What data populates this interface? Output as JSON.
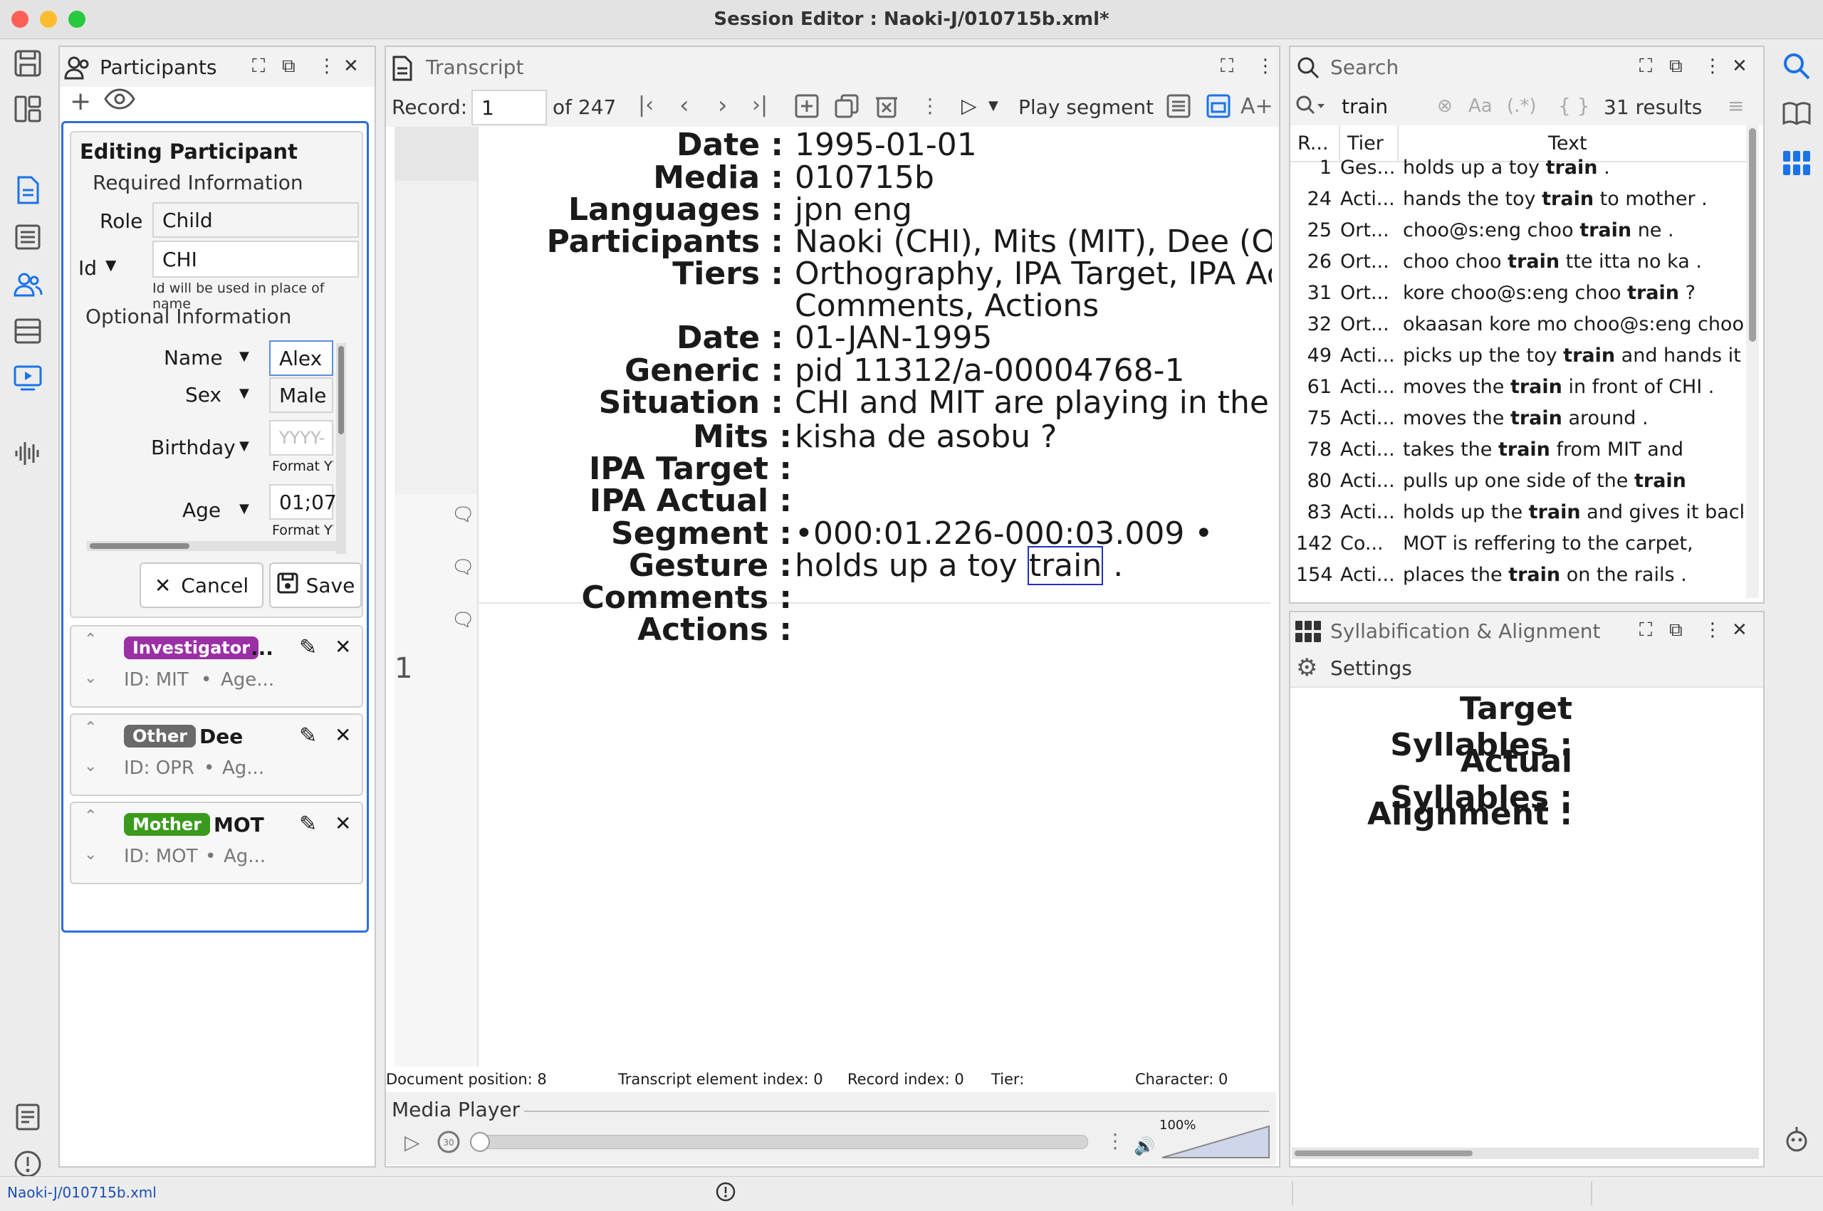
{
  "window": {
    "title": "Session Editor : Naoki-J/010715b.xml*"
  },
  "participants": {
    "title": "Participants",
    "editing_title": "Editing Participant",
    "required_label": "Required Information",
    "role_label": "Role",
    "role_value": "Child",
    "id_label": "Id",
    "id_value": "CHI",
    "id_hint": "Id will be used in place of name",
    "optional_label": "Optional Information",
    "name_label": "Name",
    "name_value": "Alex",
    "sex_label": "Sex",
    "sex_value": "Male",
    "birthday_label": "Birthday",
    "birthday_placeholder": "YYYY-",
    "format1": "Format YY",
    "age_label": "Age",
    "age_value": "01;07",
    "format2": "Format YY",
    "cancel_label": "Cancel",
    "save_label": "Save",
    "cards": [
      {
        "badge": "Investigator",
        "badge_color": "#9b2fa6",
        "name": "...",
        "id_text": "ID: MIT",
        "age_text": "Age..."
      },
      {
        "badge": "Other",
        "badge_color": "#6a6a6a",
        "name": "Dee",
        "id_text": "ID: OPR",
        "age_text": "Ag..."
      },
      {
        "badge": "Mother",
        "badge_color": "#3a9a1c",
        "name": "MOT",
        "id_text": "ID: MOT",
        "age_text": "Ag..."
      }
    ]
  },
  "transcript": {
    "title": "Transcript",
    "record_label": "Record:",
    "record_value": "1",
    "of_total": "of 247",
    "play_label": "Play segment",
    "header_rows": [
      {
        "label": "Date :",
        "value": "1995-01-01"
      },
      {
        "label": "Media :",
        "value": "010715b"
      },
      {
        "label": "Languages :",
        "value": "jpn eng"
      },
      {
        "label": "Participants :",
        "value": "Naoki (CHI), Mits (MIT), Dee (OPR), M"
      },
      {
        "label": "Tiers :",
        "value": "Orthography, IPA Target, IPA Actua"
      },
      {
        "label": "",
        "value": "Comments, Actions"
      },
      {
        "label": "Date :",
        "value": "01-JAN-1995"
      },
      {
        "label": "Generic :",
        "value": "pid 11312/a-00004768-1"
      },
      {
        "label": "Situation :",
        "value": "CHI and MIT are playing in the livin"
      }
    ],
    "record_number": "1",
    "record_rows": [
      {
        "label": "Mits :",
        "value": "kisha de asobu ?"
      },
      {
        "label": "IPA Target :",
        "value": ""
      },
      {
        "label": "IPA Actual :",
        "value": ""
      },
      {
        "label": "Segment :",
        "value": "•000:01.226-000:03.009 •"
      },
      {
        "label": "Gesture :",
        "value": "holds up a toy "
      },
      {
        "label": "Comments :",
        "value": ""
      },
      {
        "label": "Actions :",
        "value": ""
      }
    ],
    "gesture_highlight": "train",
    "gesture_end": " .",
    "status": {
      "doc_pos": "Document position: 8",
      "elem_index": "Transcript element index: 0",
      "record_index": "Record index: 0",
      "tier": "Tier:",
      "character": "Character: 0"
    },
    "media_title": "Media Player",
    "volume": "100%"
  },
  "search": {
    "title": "Search",
    "query": "train",
    "results_count": "31 results",
    "col_r": "R...",
    "col_tier": "Tier",
    "col_text": "Text",
    "rows": [
      {
        "n": "1",
        "tier": "Ges...",
        "pre": "holds up a toy ",
        "hit": "train",
        "post": " ."
      },
      {
        "n": "24",
        "tier": "Acti...",
        "pre": "hands the toy ",
        "hit": "train",
        "post": " to mother ."
      },
      {
        "n": "25",
        "tier": "Ort...",
        "pre": "choo@s:eng choo ",
        "hit": "train",
        "post": " ne ."
      },
      {
        "n": "26",
        "tier": "Ort...",
        "pre": "choo choo ",
        "hit": "train",
        "post": " tte itta no ka ."
      },
      {
        "n": "31",
        "tier": "Ort...",
        "pre": "kore choo@s:eng choo ",
        "hit": "train",
        "post": " ?"
      },
      {
        "n": "32",
        "tier": "Ort...",
        "pre": "okaasan kore mo choo@s:eng choo",
        "hit": "",
        "post": ""
      },
      {
        "n": "49",
        "tier": "Acti...",
        "pre": "picks up the toy ",
        "hit": "train",
        "post": " and hands it"
      },
      {
        "n": "61",
        "tier": "Acti...",
        "pre": "moves the ",
        "hit": "train",
        "post": " in front of CHI ."
      },
      {
        "n": "75",
        "tier": "Acti...",
        "pre": "moves the ",
        "hit": "train",
        "post": " around ."
      },
      {
        "n": "78",
        "tier": "Acti...",
        "pre": "takes the ",
        "hit": "train",
        "post": " from MIT and"
      },
      {
        "n": "80",
        "tier": "Acti...",
        "pre": "pulls up one side of the ",
        "hit": "train",
        "post": ""
      },
      {
        "n": "83",
        "tier": "Acti...",
        "pre": "holds up the ",
        "hit": "train",
        "post": " and gives it back"
      },
      {
        "n": "142",
        "tier": "Co...",
        "pre": "MOT is reffering to the carpet,",
        "hit": "",
        "post": ""
      },
      {
        "n": "154",
        "tier": "Acti...",
        "pre": "places the ",
        "hit": "train",
        "post": " on the rails ."
      }
    ]
  },
  "syllab": {
    "title": "Syllabification & Alignment",
    "settings_label": "Settings",
    "target": "Target Syllables :",
    "actual": "Actual Syllables :",
    "alignment": "Alignment :"
  },
  "statusbar": {
    "file": "Naoki-J/010715b.xml"
  }
}
